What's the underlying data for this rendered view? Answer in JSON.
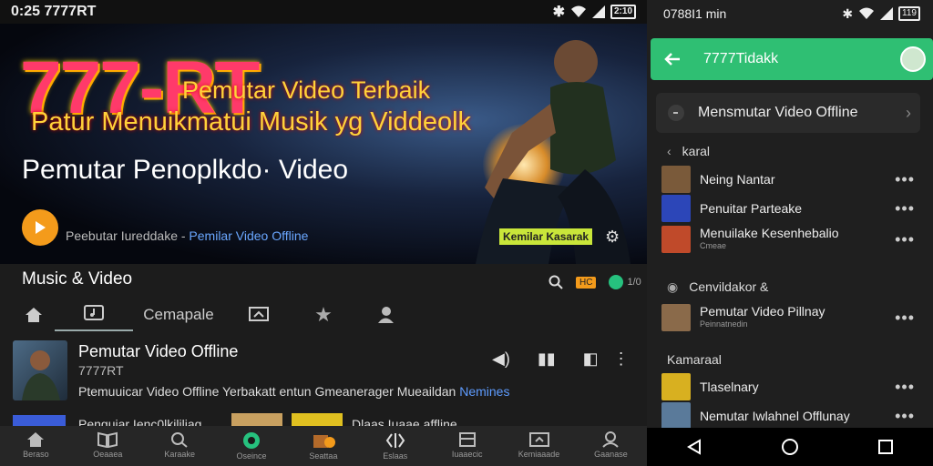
{
  "left": {
    "status": {
      "time": "0:25 7777RT",
      "battery": "2:10"
    },
    "hero": {
      "title_big": "777-RT",
      "title_line2": "Pemutar Video Terbaik",
      "title_line3": "Patur Menuikmatui Musik yg Viddeolk",
      "subtitle": "Pemutar Penoplkdo· Video",
      "footer_prefix": "Peebutar Iureddake - ",
      "footer_link": "Pemilar Video Offline",
      "badge": "Kemilar Kasarak"
    },
    "section": {
      "title": "Music & Video",
      "badge": "HC",
      "badge2": "1/0"
    },
    "tabs": [
      {
        "label": "",
        "icon": "home-icon"
      },
      {
        "label": "",
        "icon": "music-note-icon"
      },
      {
        "label": "Cemapale",
        "icon": ""
      },
      {
        "label": "",
        "icon": "screen-cast-icon"
      },
      {
        "label": "",
        "icon": "star-icon"
      },
      {
        "label": "",
        "icon": "user-icon"
      }
    ],
    "item": {
      "title": "Pemutar Video Offline",
      "channel": "7777RT",
      "description": "Ptemuuicar Video Offline Yerbakatt entun Gmeanerager Mueaildan ",
      "more": "Nemines"
    },
    "item2": {
      "title": "Penguiar Ienc0lkililiag",
      "title2": "Dlaas Iuaae affline"
    },
    "bottom_nav": [
      {
        "label": "Beraso",
        "icon": "home-icon"
      },
      {
        "label": "Oeaaea",
        "icon": "book-icon"
      },
      {
        "label": "Karaake",
        "icon": "search-icon"
      },
      {
        "label": "Oseince",
        "icon": "location-icon"
      },
      {
        "label": "Seattaa",
        "icon": "folder-icon"
      },
      {
        "label": "Eslaas",
        "icon": "code-icon"
      },
      {
        "label": "Iuaaecic",
        "icon": "inbox-icon"
      },
      {
        "label": "Kemiaaade",
        "icon": "screen-icon"
      },
      {
        "label": "Gaanase",
        "icon": "profile-icon"
      }
    ]
  },
  "right": {
    "status": {
      "time": "0788Ι1 min",
      "battery": "119"
    },
    "header": {
      "title": "7777Tidakk"
    },
    "offline_card": {
      "label": "Mensmutar Video Offline"
    },
    "groups": [
      {
        "heading": "karal",
        "items": [
          {
            "title": "Neing Nantar",
            "sub": "",
            "color": "#7a5a3a"
          },
          {
            "title": "Penuitar Parteake",
            "sub": "",
            "color": "#2c46b8"
          },
          {
            "title": "Menuilake Kesenhebalio",
            "sub": "Cmeae",
            "color": "#c04a2a"
          }
        ]
      },
      {
        "heading": "Cenvildakor &",
        "items": [
          {
            "title": "Pemutar Video Pillnay",
            "sub": "Peinnatnedin",
            "color": "#8a6a4a"
          }
        ]
      },
      {
        "heading": "Kamaraal",
        "items": [
          {
            "title": "Tlaselnary",
            "sub": "",
            "color": "#d8b020"
          },
          {
            "title": "Nemutar Iwlahnel Offlunay",
            "sub": "",
            "color": "#5a7a9a"
          }
        ]
      }
    ]
  }
}
